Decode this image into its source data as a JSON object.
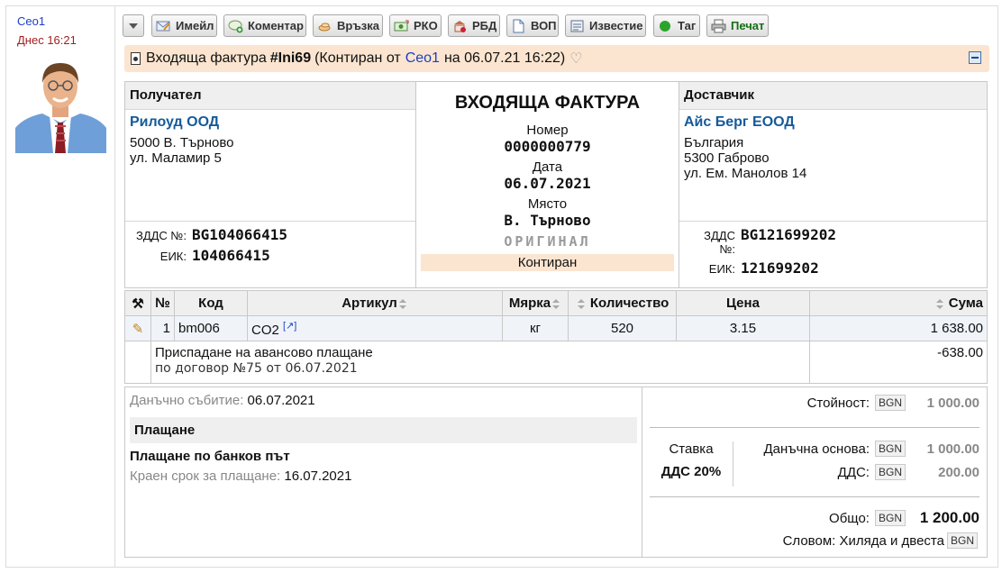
{
  "sidebar": {
    "user": "Ceo1",
    "date": "Днес 16:21"
  },
  "toolbar": {
    "buttons": [
      {
        "label": "Имейл",
        "icon": "email-edit-icon"
      },
      {
        "label": "Коментар",
        "icon": "comment-add-icon"
      },
      {
        "label": "Връзка",
        "icon": "link-icon"
      },
      {
        "label": "РКО",
        "icon": "cash-out-icon"
      },
      {
        "label": "РБД",
        "icon": "bank-doc-icon"
      },
      {
        "label": "ВОП",
        "icon": "document-icon"
      },
      {
        "label": "Известие",
        "icon": "notice-icon"
      },
      {
        "label": "Таг",
        "icon": "tag-green-icon"
      },
      {
        "label": "Печат",
        "icon": "print-icon"
      }
    ]
  },
  "header": {
    "doc_type": "Входяща фактура",
    "number": "#Ini69",
    "status_prefix": "(Контиран от",
    "user": "Ceo1",
    "status_suffix": "на 06.07.21 16:22)"
  },
  "invoice": {
    "recipient_title": "Получател",
    "recipient_name": "Рилоуд ООД",
    "recipient_addr1": "5000 В. Търново",
    "recipient_addr2": "ул. Маламир 5",
    "recipient_vat_label": "ЗДДС №:",
    "recipient_vat": "BG104066415",
    "recipient_eik_label": "ЕИК:",
    "recipient_eik": "104066415",
    "title": "ВХОДЯЩА ФАКТУРА",
    "number_label": "Номер",
    "number": "0000000779",
    "date_label": "Дата",
    "date": "06.07.2021",
    "place_label": "Място",
    "place": "В. Търново",
    "original": "ОРИГИНАЛ",
    "state": "Контиран",
    "supplier_title": "Доставчик",
    "supplier_name": "Айс Берг ЕООД",
    "supplier_addr1": "България",
    "supplier_addr2": "5300 Габрово",
    "supplier_addr3": "ул. Ем. Манолов 14",
    "supplier_vat_label": "ЗДДС №:",
    "supplier_vat": "BG121699202",
    "supplier_eik_label": "ЕИК:",
    "supplier_eik": "121699202"
  },
  "items": {
    "headers": {
      "no": "№",
      "code": "Код",
      "article": "Артикул",
      "unit": "Мярка",
      "qty": "Количество",
      "price": "Цена",
      "sum": "Сума"
    },
    "row": {
      "no": "1",
      "code": "bm006",
      "article": "CO2",
      "unit": "кг",
      "qty": "520",
      "price": "3.15",
      "sum": "1 638.00"
    },
    "advance_title": "Приспадане на авансово плащане",
    "advance_desc": "по договор №75 от 06.07.2021",
    "advance_sum": "-638.00"
  },
  "payment": {
    "tax_event_label": "Данъчно събитие:",
    "tax_event": "06.07.2021",
    "title": "Плащане",
    "method": "Плащане по банков път",
    "due_label": "Краен срок за плащане:",
    "due": "16.07.2021"
  },
  "totals": {
    "currency": "BGN",
    "value_label": "Стойност:",
    "value": "1 000.00",
    "rate_label": "Ставка",
    "rate": "ДДС 20%",
    "base_label": "Данъчна основа:",
    "base": "1 000.00",
    "vat_label": "ДДС:",
    "vat": "200.00",
    "total_label": "Общо:",
    "total": "1 200.00",
    "words_label": "Словом:",
    "words": "Хиляда и двеста"
  }
}
